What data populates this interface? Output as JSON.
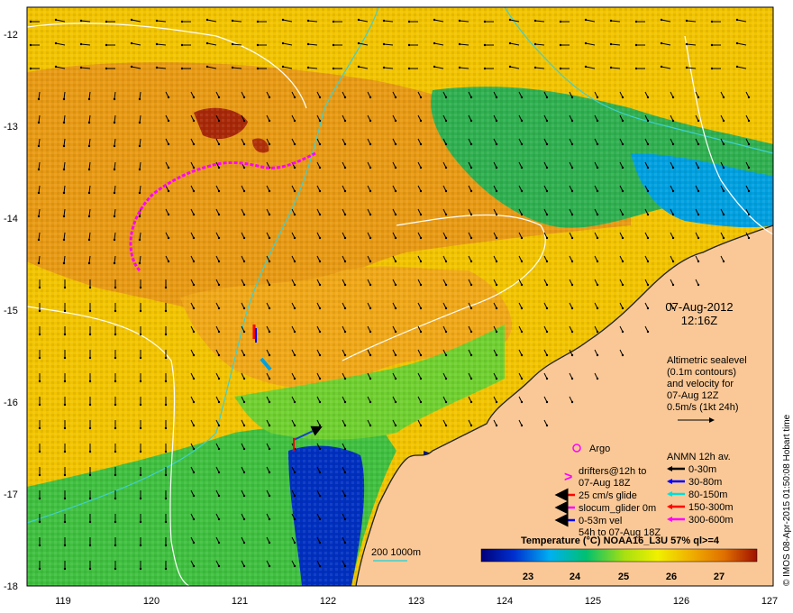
{
  "map": {
    "lon_ticks": [
      "119",
      "120",
      "121",
      "122",
      "123",
      "124",
      "125",
      "126",
      "127"
    ],
    "lat_ticks": [
      "-12",
      "-13",
      "-14",
      "-15",
      "-16",
      "-17",
      "-18"
    ],
    "date": "07-Aug-2012",
    "time": "12:16Z",
    "altimetry_note": [
      "Altimetric sealevel",
      "(0.1m contours)",
      "and velocity for",
      "07-Aug 12Z",
      "0.5m/s (1kt 24h)"
    ],
    "depth_contours_label": "200  1000m",
    "credit": "© IMOS 08-Apr-2015 01:50:08 Hobart time"
  },
  "legend": {
    "argo": "Argo",
    "drifters": [
      "drifters@12h to",
      "07-Aug 18Z"
    ],
    "glide": "25 cm/s glide",
    "slocum": "slocum_glider 0m",
    "vel": [
      "0-53m vel",
      "54h to 07-Aug 18Z"
    ],
    "anmn_title": "ANMN 12h av.",
    "anmn": [
      {
        "label": "0-30m",
        "color": "#000000"
      },
      {
        "label": "30-80m",
        "color": "#0000ff"
      },
      {
        "label": "80-150m",
        "color": "#00e0e0"
      },
      {
        "label": "150-300m",
        "color": "#ff0000"
      },
      {
        "label": "300-600m",
        "color": "#ff00ff"
      }
    ]
  },
  "colorbar": {
    "title": "Temperature (°C) NOAA16_L3U 57% ql>=4",
    "ticks": [
      "23",
      "24",
      "25",
      "26",
      "27"
    ]
  }
}
